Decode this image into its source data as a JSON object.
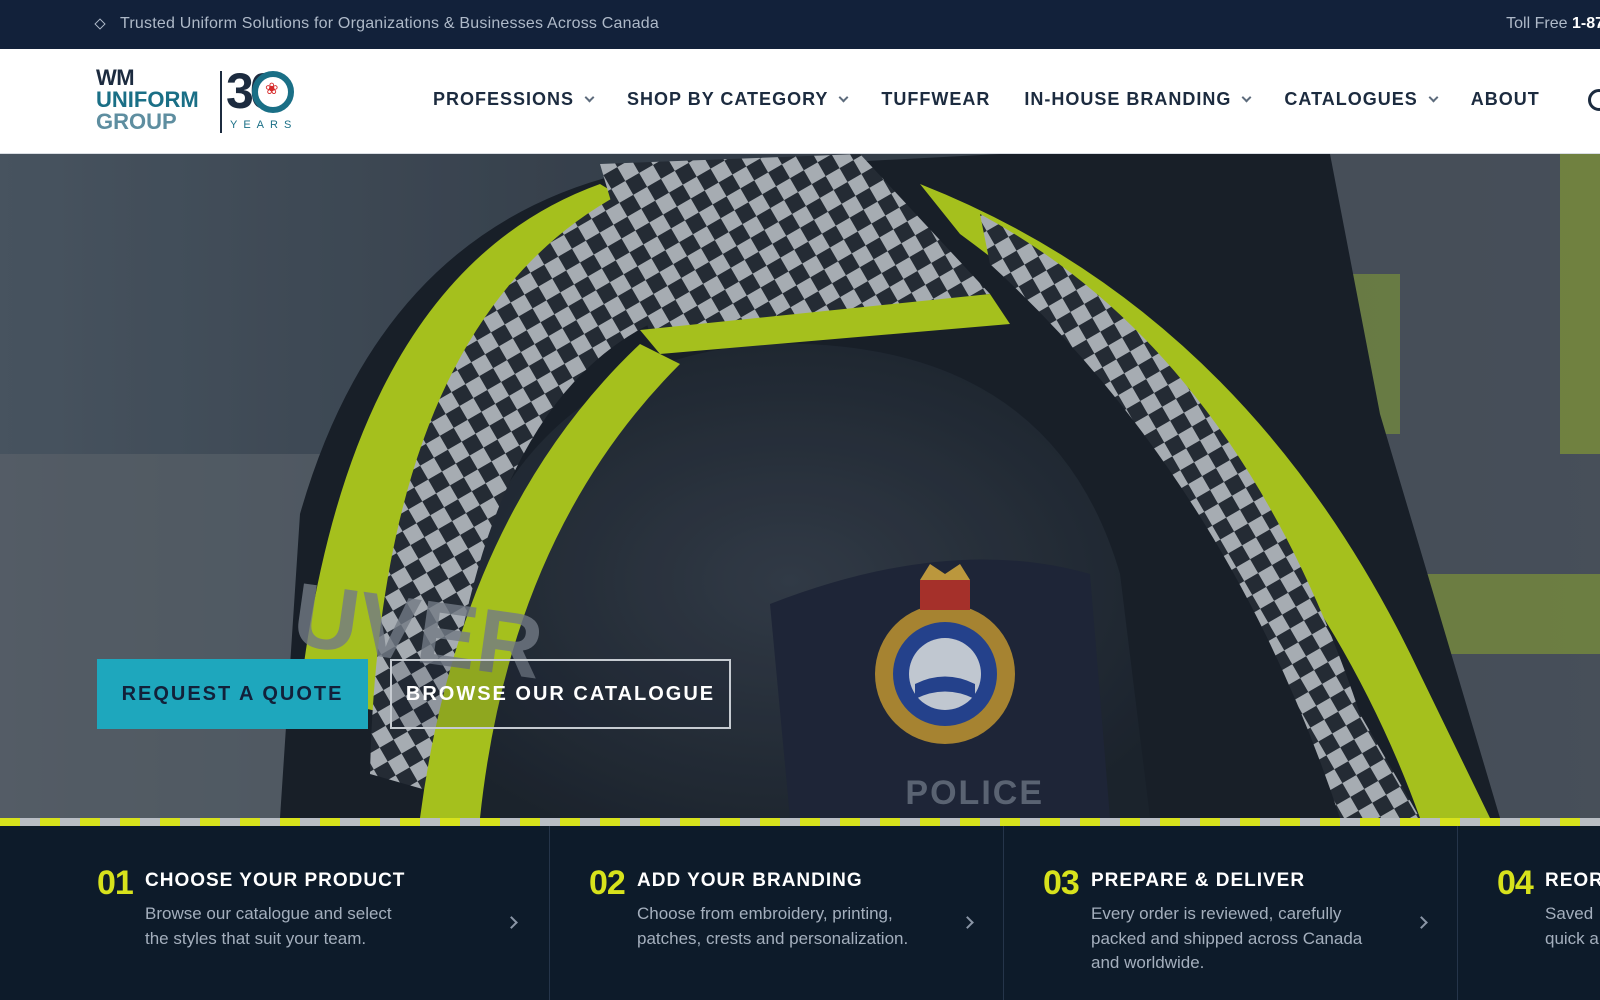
{
  "topbar": {
    "tagline": "Trusted Uniform Solutions for Organizations & Businesses Across Canada",
    "toll_label": "Toll Free",
    "toll_number": "1-87"
  },
  "logo": {
    "line1": "WM",
    "line2": "UNIFORM",
    "line3": "GROUP",
    "anniversary": "30",
    "years": "YEARS"
  },
  "nav": {
    "items": [
      {
        "label": "PROFESSIONS",
        "dropdown": true
      },
      {
        "label": "SHOP BY CATEGORY",
        "dropdown": true
      },
      {
        "label": "TUFFWEAR",
        "dropdown": false
      },
      {
        "label": "IN-HOUSE BRANDING",
        "dropdown": true
      },
      {
        "label": "CATALOGUES",
        "dropdown": true
      },
      {
        "label": "ABOUT",
        "dropdown": false
      }
    ]
  },
  "hero": {
    "quote_label": "REQUEST A QUOTE",
    "browse_label": "BROWSE OUR CATALOGUE",
    "sleeve_text": "UVER",
    "badge_text": "POLICE"
  },
  "steps": [
    {
      "num": "01",
      "title": "CHOOSE YOUR PRODUCT",
      "desc": "Browse our catalogue and select the styles that suit your team."
    },
    {
      "num": "02",
      "title": "ADD YOUR BRANDING",
      "desc": "Choose from embroidery, printing, patches, crests and personalization."
    },
    {
      "num": "03",
      "title": "PREPARE & DELIVER",
      "desc": "Every order is reviewed, carefully packed and shipped across Canada and worldwide."
    },
    {
      "num": "04",
      "title": "REORD",
      "desc": "Saved quick a"
    }
  ],
  "colors": {
    "navy": "#12213a",
    "teal": "#1ea7bd",
    "hi_vis": "#d7e21c"
  }
}
